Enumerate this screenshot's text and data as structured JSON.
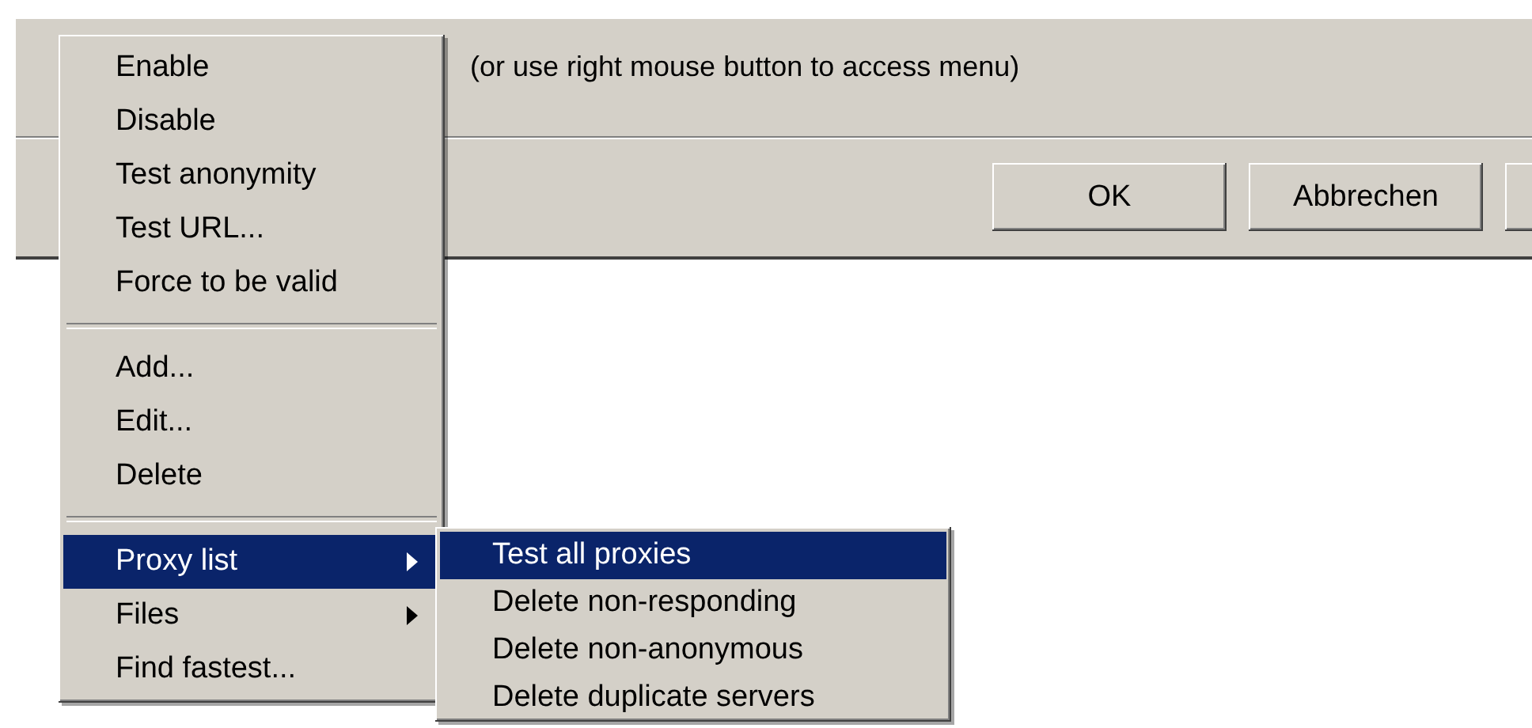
{
  "dialog": {
    "hint": "(or use right mouse button to access menu)",
    "buttons": [
      {
        "label": "OK"
      },
      {
        "label": "Abbrechen"
      }
    ]
  },
  "context_menu": {
    "items": [
      {
        "kind": "item",
        "label": "Enable",
        "selected": false,
        "submenu": false
      },
      {
        "kind": "item",
        "label": "Disable",
        "selected": false,
        "submenu": false
      },
      {
        "kind": "item",
        "label": "Test anonymity",
        "selected": false,
        "submenu": false
      },
      {
        "kind": "item",
        "label": "Test URL...",
        "selected": false,
        "submenu": false
      },
      {
        "kind": "item",
        "label": "Force to be valid",
        "selected": false,
        "submenu": false
      },
      {
        "kind": "separator"
      },
      {
        "kind": "item",
        "label": "Add...",
        "selected": false,
        "submenu": false
      },
      {
        "kind": "item",
        "label": "Edit...",
        "selected": false,
        "submenu": false
      },
      {
        "kind": "item",
        "label": "Delete",
        "selected": false,
        "submenu": false
      },
      {
        "kind": "separator"
      },
      {
        "kind": "item",
        "label": "Proxy list",
        "selected": true,
        "submenu": true
      },
      {
        "kind": "item",
        "label": "Files",
        "selected": false,
        "submenu": true
      },
      {
        "kind": "item",
        "label": "Find fastest...",
        "selected": false,
        "submenu": false
      }
    ]
  },
  "submenu": {
    "items": [
      {
        "label": "Test all proxies",
        "selected": true
      },
      {
        "label": "Delete non-responding",
        "selected": false
      },
      {
        "label": "Delete non-anonymous",
        "selected": false
      },
      {
        "label": "Delete duplicate servers",
        "selected": false
      }
    ]
  }
}
